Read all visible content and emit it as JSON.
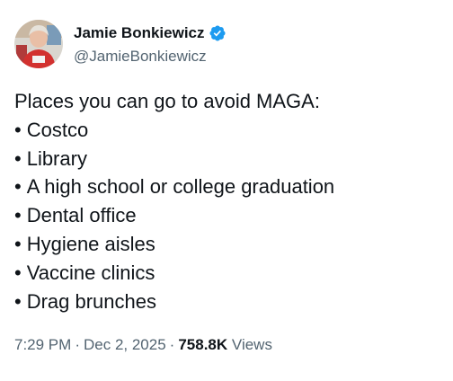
{
  "author": {
    "display_name": "Jamie Bonkiewicz",
    "handle": "@JamieBonkiewicz",
    "verified": true,
    "verified_color": "#1d9bf0"
  },
  "tweet": {
    "intro": "Places you can go to avoid MAGA:",
    "bullet_char": "•",
    "items": [
      "Costco",
      "Library",
      "A high school or college graduation",
      "Dental office",
      "Hygiene aisles",
      "Vaccine clinics",
      "Drag brunches"
    ]
  },
  "meta": {
    "time": "7:29 PM",
    "separator": "·",
    "date": "Dec 2, 2025",
    "views_count": "758.8K",
    "views_label": "Views"
  },
  "icons": {
    "avatar": "profile-avatar",
    "verified": "verified-badge-icon"
  }
}
